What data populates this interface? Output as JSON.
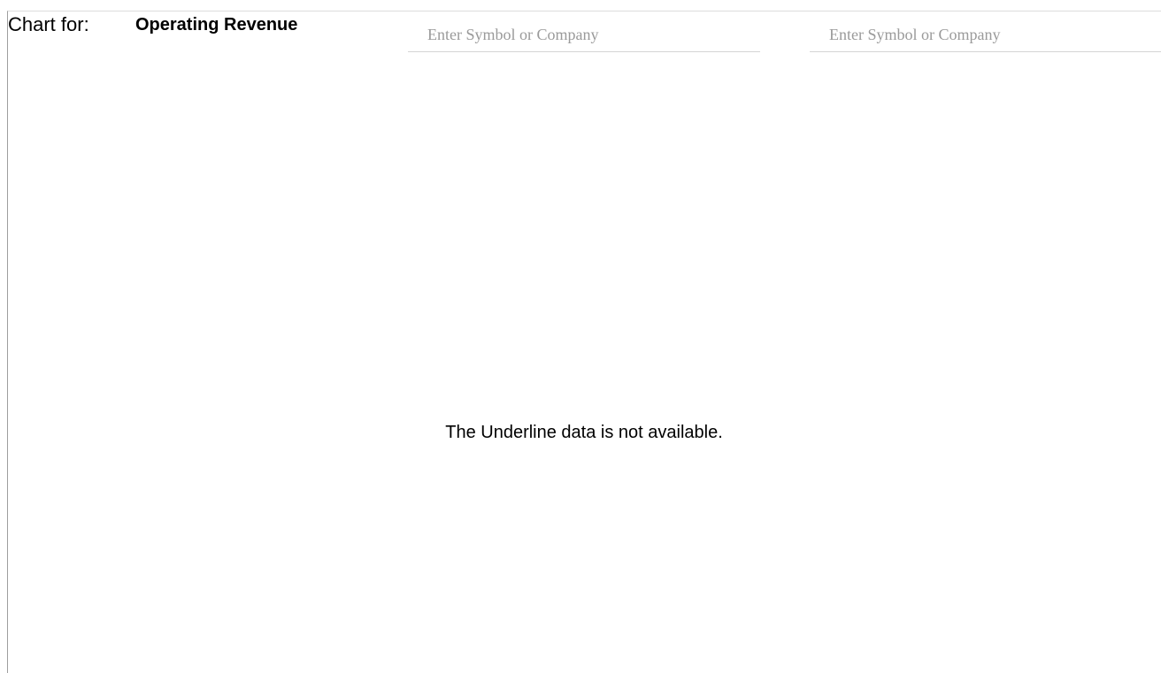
{
  "header": {
    "chart_for_label": "Chart for:",
    "metric": "Operating Revenue"
  },
  "compare": {
    "fields": [
      {
        "placeholder": "Enter Symbol or Company",
        "value": ""
      },
      {
        "placeholder": "Enter Symbol or Company",
        "value": ""
      }
    ]
  },
  "chart": {
    "message": "The Underline data is not available."
  }
}
